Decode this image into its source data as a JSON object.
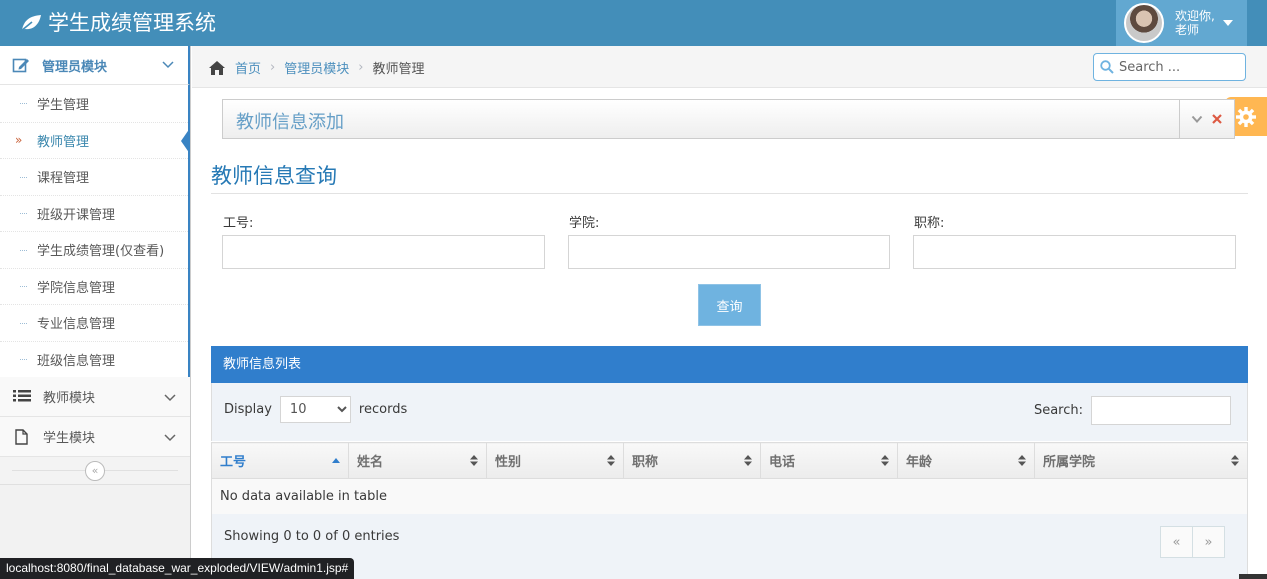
{
  "app": {
    "brand": "学生成绩管理系统",
    "brand_icon": "leaf-icon"
  },
  "user": {
    "welcome_line1": "欢迎你,",
    "welcome_line2": "老师"
  },
  "sidebar": {
    "admin_module": "管理员模块",
    "items": [
      {
        "label": "学生管理",
        "active": false
      },
      {
        "label": "教师管理",
        "active": true
      },
      {
        "label": "课程管理",
        "active": false
      },
      {
        "label": "班级开课管理",
        "active": false
      },
      {
        "label": "学生成绩管理(仅查看)",
        "active": false
      },
      {
        "label": "学院信息管理",
        "active": false
      },
      {
        "label": "专业信息管理",
        "active": false
      },
      {
        "label": "班级信息管理",
        "active": false
      }
    ],
    "teacher_module": "教师模块",
    "student_module": "学生模块",
    "collapse_symbol": "«",
    "active_arrow": "»"
  },
  "breadcrumb": {
    "home": "首页",
    "sep": "›",
    "module": "管理员模块",
    "current": "教师管理"
  },
  "search": {
    "placeholder": "Search ..."
  },
  "widget": {
    "title": "教师信息添加"
  },
  "query": {
    "title": "教师信息查询",
    "label_id": "工号:",
    "label_college": "学院:",
    "label_title": "职称:",
    "button": "查询"
  },
  "table": {
    "header": "教师信息列表",
    "display_label": "Display",
    "display_value": "10",
    "records_label": "records",
    "search_label": "Search:",
    "columns": [
      "工号",
      "姓名",
      "性别",
      "职称",
      "电话",
      "年龄",
      "所属学院"
    ],
    "empty": "No data available in table",
    "info": "Showing 0 to 0 of 0 entries",
    "prev": "«",
    "next": "»"
  },
  "status_bar": {
    "url": "localhost:8080/final_database_war_exploded/VIEW/admin1.jsp#"
  },
  "colors": {
    "navbar": "#438eb9",
    "accent": "#307ecc",
    "button": "#6fb3e0",
    "settings": "#ffb752"
  }
}
